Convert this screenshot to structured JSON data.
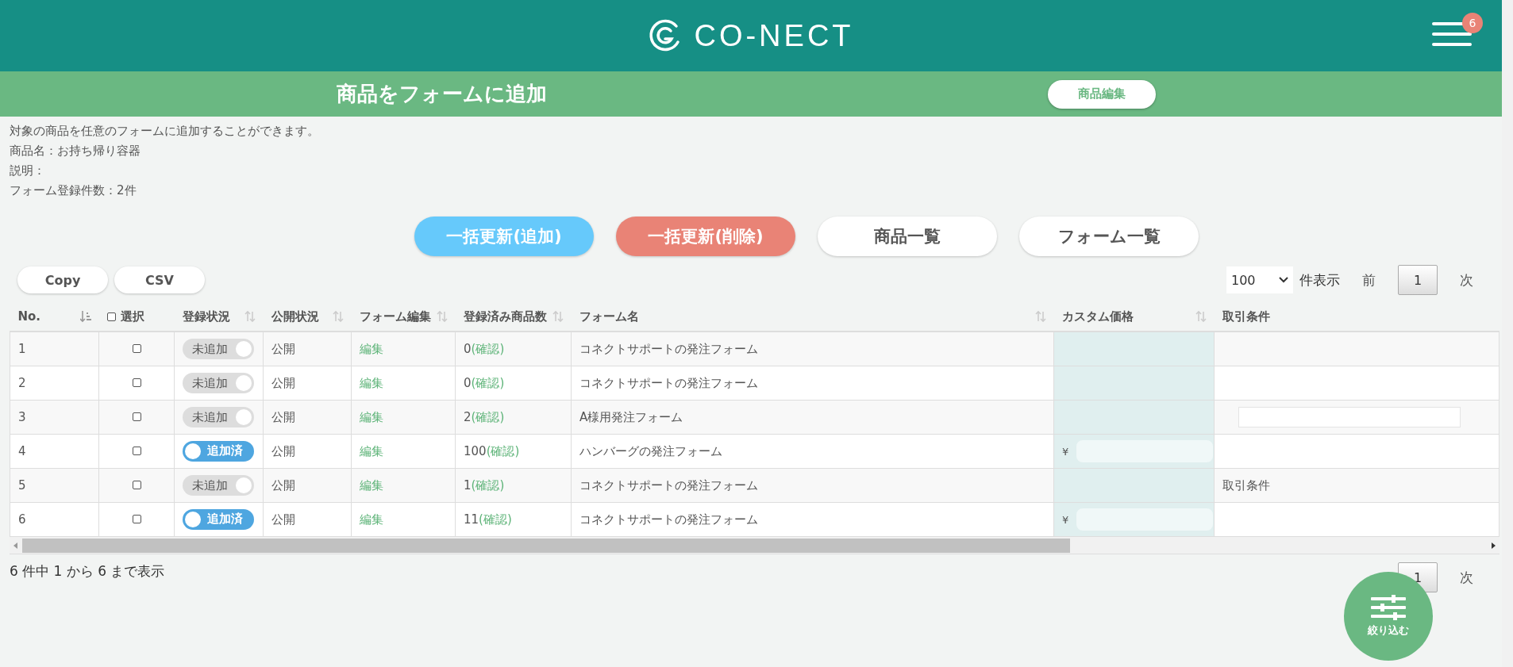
{
  "header": {
    "logo": "CO-NECT",
    "badge": "6"
  },
  "title_bar": {
    "title": "商品をフォームに追加",
    "button": "商品編集"
  },
  "info": [
    "対象の商品を任意のフォームに追加することができます。",
    "商品名：お持ち帰り容器",
    "説明：",
    "フォーム登録件数：2件"
  ],
  "actions": [
    {
      "label": "一括更新(追加)",
      "kind": "add"
    },
    {
      "label": "一括更新(削除)",
      "kind": "delete"
    },
    {
      "label": "商品一覧",
      "kind": "plain"
    },
    {
      "label": "フォーム一覧",
      "kind": "plain"
    }
  ],
  "export_buttons": [
    "Copy",
    "CSV"
  ],
  "page_size": {
    "value": "100",
    "label": "件表示"
  },
  "pager": {
    "prev": "前",
    "page": "1",
    "next": "次"
  },
  "table": {
    "select_all_checked": false,
    "columns": [
      {
        "label": "No.",
        "kind": "sorted"
      },
      {
        "label": "選択",
        "kind": "plain"
      },
      {
        "label": "登録状況",
        "kind": "sortable"
      },
      {
        "label": "公開状況",
        "kind": "sortable"
      },
      {
        "label": "フォーム編集",
        "kind": "sortable"
      },
      {
        "label": "登録済み商品数",
        "kind": "sortable"
      },
      {
        "label": "フォーム名",
        "kind": "sortable"
      },
      {
        "label": "カスタム価格",
        "kind": "sortable"
      },
      {
        "label": "取引条件",
        "kind": "plain"
      }
    ],
    "rows": [
      {
        "no": "1",
        "checked": false,
        "added": false,
        "toggle": "未追加",
        "public": "公開",
        "edit": "編集",
        "count": "0",
        "confirm": "(確認)",
        "form": "コネクトサポートの発注フォーム",
        "terms_field": false
      },
      {
        "no": "2",
        "checked": false,
        "added": false,
        "toggle": "未追加",
        "public": "公開",
        "edit": "編集",
        "count": "0",
        "confirm": "(確認)",
        "form": "コネクトサポートの発注フォーム",
        "terms_field": false
      },
      {
        "no": "3",
        "checked": false,
        "added": false,
        "toggle": "未追加",
        "public": "公開",
        "edit": "編集",
        "count": "2",
        "confirm": "(確認)",
        "form": "A様用発注フォーム",
        "terms_field": true
      },
      {
        "no": "4",
        "checked": false,
        "added": true,
        "toggle": "追加済",
        "public": "公開",
        "edit": "編集",
        "count": "100",
        "confirm": "(確認)",
        "form": "ハンバーグの発注フォーム",
        "currency": "¥",
        "terms_field": false
      },
      {
        "no": "5",
        "checked": false,
        "added": false,
        "toggle": "未追加",
        "public": "公開",
        "edit": "編集",
        "count": "1",
        "confirm": "(確認)",
        "form": "コネクトサポートの発注フォーム",
        "terms": "取引条件",
        "terms_field": false
      },
      {
        "no": "6",
        "checked": false,
        "added": true,
        "toggle": "追加済",
        "public": "公開",
        "edit": "編集",
        "count": "11",
        "confirm": "(確認)",
        "form": "コネクトサポートの発注フォーム",
        "currency": "¥",
        "terms_field": false
      }
    ]
  },
  "summary": "6 件中 1 から 6 まで表示",
  "bottom_pager": {
    "page": "1",
    "next": "次"
  },
  "filter_button": "絞り込む"
}
